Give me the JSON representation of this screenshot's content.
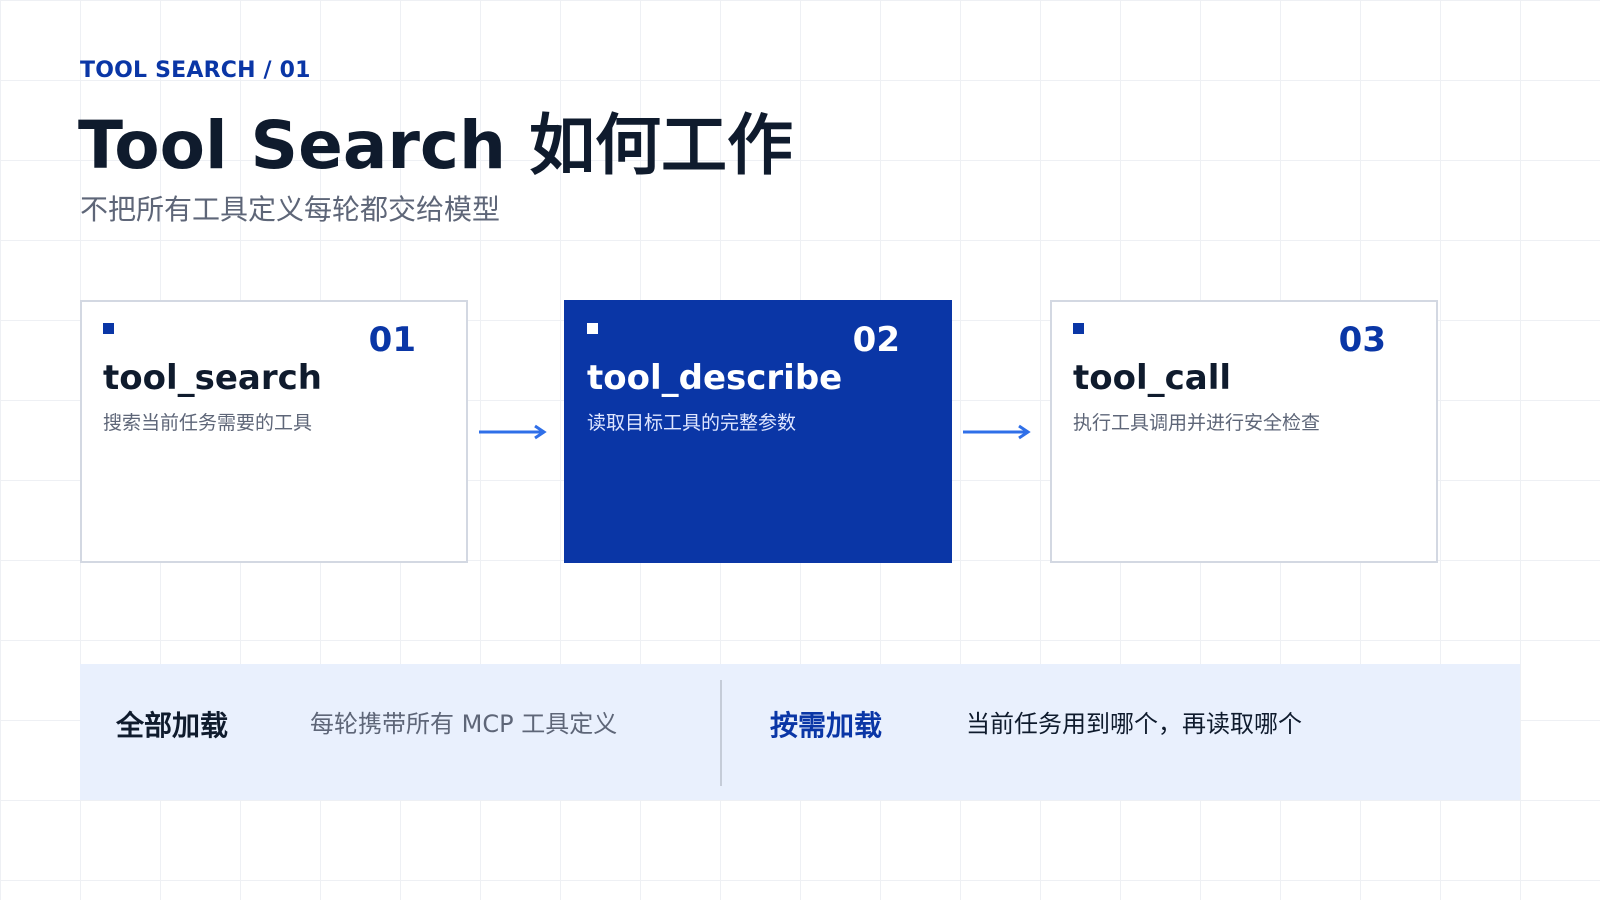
{
  "header": {
    "eyebrow": "TOOL SEARCH / 01",
    "title": "Tool Search 如何工作",
    "subtitle": "不把所有工具定义每轮都交给模型"
  },
  "steps": [
    {
      "number": "01",
      "name": "tool_search",
      "description": "搜索当前任务需要的工具",
      "active": false
    },
    {
      "number": "02",
      "name": "tool_describe",
      "description": "读取目标工具的完整参数",
      "active": true
    },
    {
      "number": "03",
      "name": "tool_call",
      "description": "执行工具调用并进行安全检查",
      "active": false
    }
  ],
  "comparison": {
    "left": {
      "label": "全部加载",
      "text": "每轮携带所有 MCP 工具定义"
    },
    "right": {
      "label": "按需加载",
      "text": "当前任务用到哪个，再读取哪个"
    }
  },
  "colors": {
    "accent": "#0a36a6",
    "arrow": "#2f6fe8",
    "panel": "#e9f0fd",
    "muted_text": "#5e6678",
    "dark_text": "#0f1b2d"
  },
  "icons": {
    "marker": "square-marker-icon",
    "arrow": "arrow-right-icon"
  }
}
